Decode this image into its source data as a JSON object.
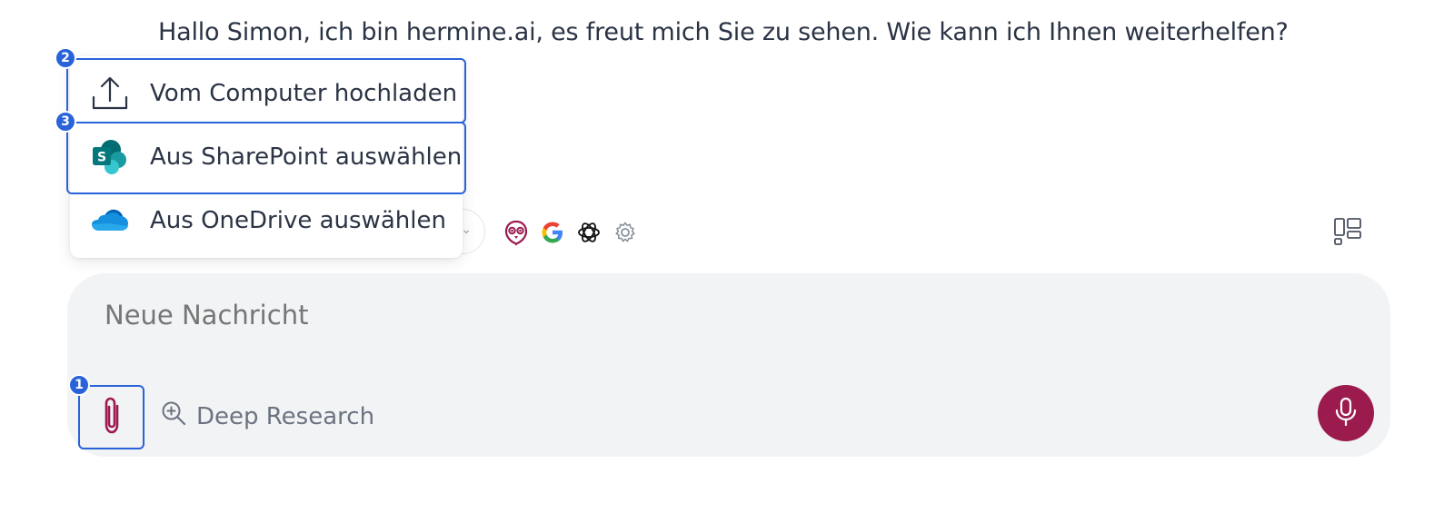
{
  "greeting": "Hallo Simon, ich bin hermine.ai, es freut mich Sie zu sehen. Wie kann ich Ihnen weiterhelfen?",
  "upload_menu": {
    "items": [
      {
        "label": "Vom Computer hochladen",
        "icon": "upload-icon"
      },
      {
        "label": "Aus SharePoint auswählen",
        "icon": "sharepoint-icon"
      },
      {
        "label": "Aus OneDrive auswählen",
        "icon": "onedrive-icon"
      }
    ]
  },
  "model_icons": [
    "hermine-owl-icon",
    "google-icon",
    "openai-icon",
    "settings-gear-icon"
  ],
  "composer": {
    "placeholder": "Neue Nachricht",
    "deep_research_label": "Deep Research"
  },
  "annotations": {
    "badge_1": "1",
    "badge_2": "2",
    "badge_3": "3"
  },
  "colors": {
    "accent": "#9c1b4f",
    "highlight": "#2a62d9",
    "composer_bg": "#f2f3f5",
    "text": "#2b3445",
    "muted_text": "#6b7380"
  }
}
